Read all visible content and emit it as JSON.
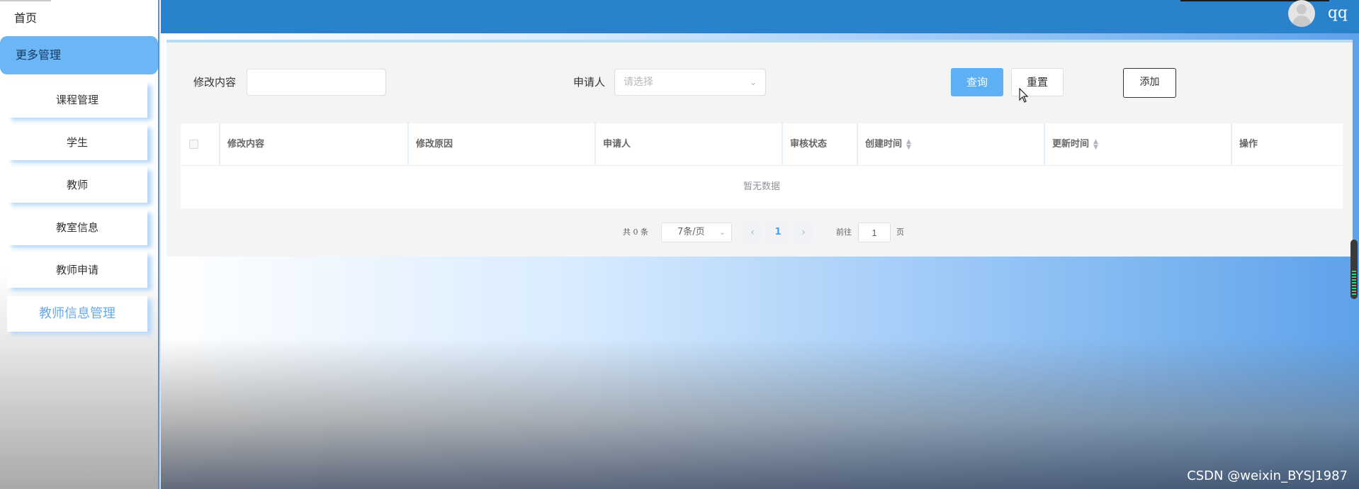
{
  "sidebar": {
    "home": "首页",
    "group": "更多管理",
    "items": [
      {
        "label": "课程管理"
      },
      {
        "label": "学生"
      },
      {
        "label": "教师"
      },
      {
        "label": "教室信息"
      },
      {
        "label": "教师申请"
      },
      {
        "label": "教师信息管理"
      }
    ]
  },
  "header": {
    "username": "qq"
  },
  "search": {
    "content_label": "修改内容",
    "content_value": "",
    "applicant_label": "申请人",
    "applicant_placeholder": "请选择",
    "query_label": "查询",
    "reset_label": "重置",
    "add_label": "添加"
  },
  "table": {
    "columns": [
      "修改内容",
      "修改原因",
      "申请人",
      "审核状态",
      "创建时间",
      "更新时间",
      "操作"
    ],
    "empty_text": "暂无数据"
  },
  "pagination": {
    "total_text": "共 0 条",
    "page_size": "7条/页",
    "current_page": "1",
    "goto_label": "前往",
    "goto_value": "1",
    "page_unit": "页"
  },
  "watermark": "CSDN @weixin_BYSJ1987"
}
